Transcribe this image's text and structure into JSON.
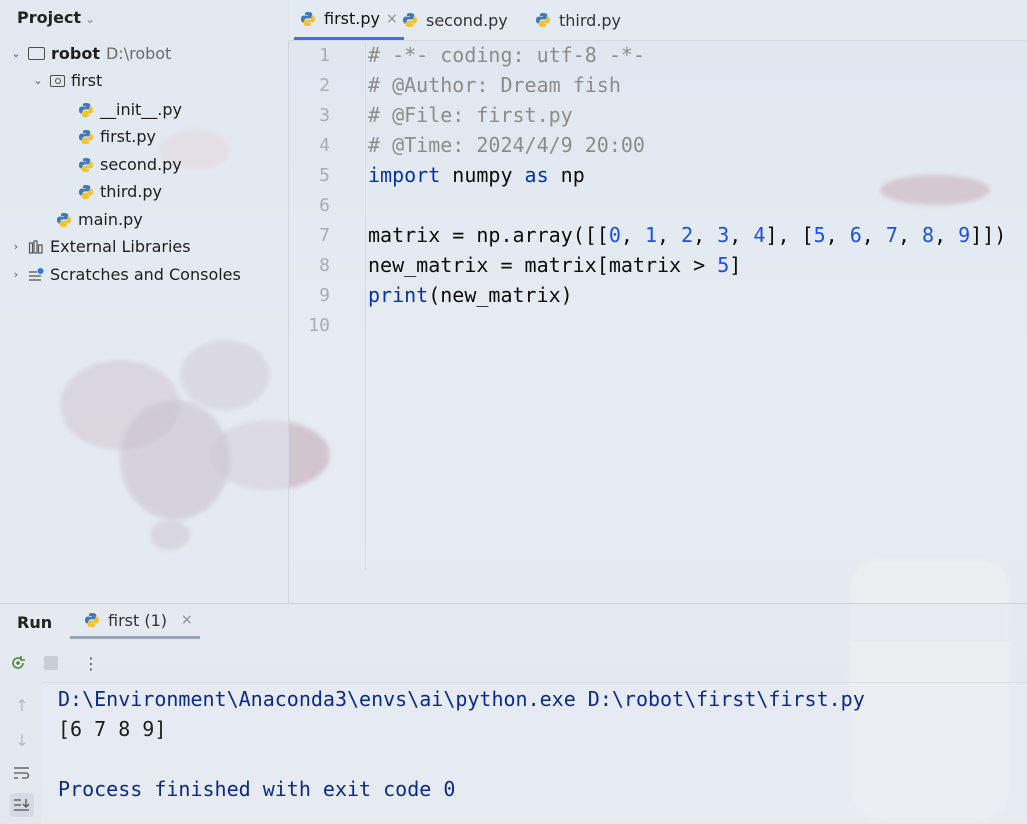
{
  "colors": {
    "accent": "#3574f0",
    "keyword": "#0033b3",
    "number": "#1750eb",
    "comment": "#8c8c8c"
  },
  "project": {
    "title": "Project",
    "tree": [
      {
        "label": "robot",
        "path": "D:\\robot",
        "icon": "folder-icon",
        "expanded": true
      },
      {
        "label": "first",
        "icon": "package-folder-icon",
        "expanded": true
      },
      {
        "label": "__init__.py",
        "icon": "python-file-icon"
      },
      {
        "label": "first.py",
        "icon": "python-file-icon"
      },
      {
        "label": "second.py",
        "icon": "python-file-icon"
      },
      {
        "label": "third.py",
        "icon": "python-file-icon"
      },
      {
        "label": "main.py",
        "icon": "python-file-icon"
      },
      {
        "label": "External Libraries",
        "icon": "library-icon"
      },
      {
        "label": "Scratches and Consoles",
        "icon": "scratches-icon"
      }
    ]
  },
  "editor": {
    "tabs": [
      {
        "label": "first.py",
        "active": true,
        "closable": true
      },
      {
        "label": "second.py"
      },
      {
        "label": "third.py"
      }
    ],
    "line_numbers": [
      "1",
      "2",
      "3",
      "4",
      "5",
      "6",
      "7",
      "8",
      "9",
      "10"
    ],
    "lines": {
      "l1": "# -*- coding: utf-8 -*-",
      "l2": "# @Author: Dream fish",
      "l3": "# @File: first.py",
      "l4": "# @Time: 2024/4/9 20:00",
      "l5a": "import",
      "l5b": " numpy ",
      "l5c": "as",
      "l5d": " np",
      "l7": {
        "pre": "matrix = np.array([[",
        "n": [
          "0",
          "1",
          "2",
          "3",
          "4",
          "5",
          "6",
          "7",
          "8",
          "9"
        ]
      },
      "l8a": "new_matrix = matrix[matrix > ",
      "l8b": "5",
      "l8c": "]",
      "l9a": "print",
      "l9b": "(new_matrix)"
    }
  },
  "run": {
    "title": "Run",
    "tab_label": "first (1)",
    "output": {
      "command": "D:\\Environment\\Anaconda3\\envs\\ai\\python.exe D:\\robot\\first\\first.py",
      "result": "[6 7 8 9]",
      "finished": "Process finished with exit code 0"
    }
  }
}
